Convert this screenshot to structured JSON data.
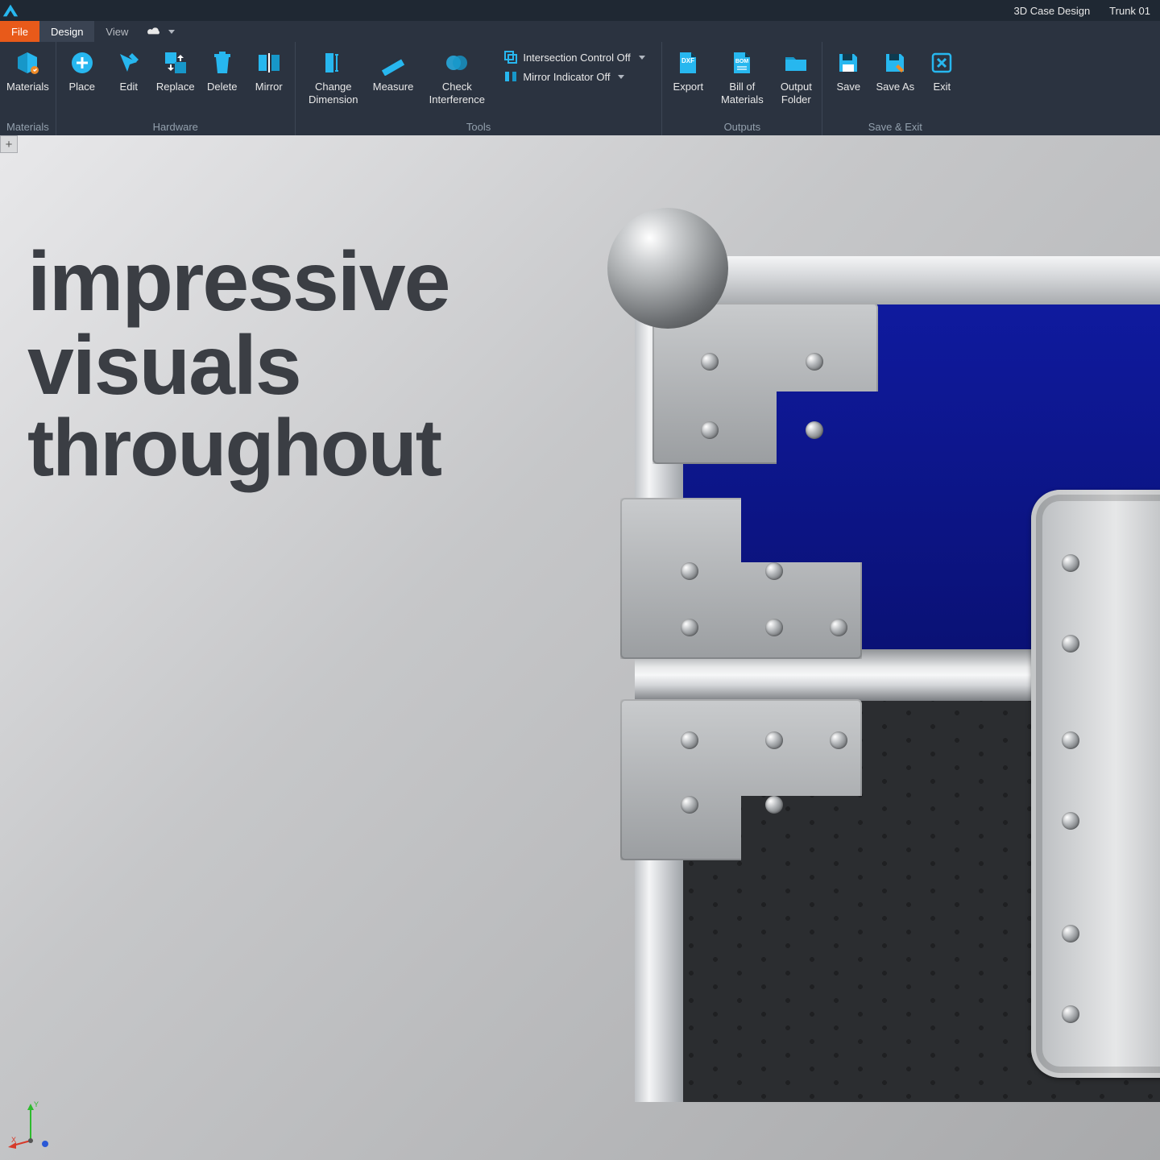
{
  "titlebar": {
    "app": "3D Case Design",
    "doc": "Trunk 01"
  },
  "menu": {
    "file": "File",
    "design": "Design",
    "view": "View"
  },
  "ribbon": {
    "materials": {
      "label": "Materials",
      "materials_btn": "Materials"
    },
    "hardware": {
      "label": "Hardware",
      "place": "Place",
      "edit": "Edit",
      "replace": "Replace",
      "delete": "Delete",
      "mirror": "Mirror"
    },
    "tools": {
      "label": "Tools",
      "change_dim": "Change\nDimension",
      "measure": "Measure",
      "check_interf": "Check\nInterference",
      "intersection": "Intersection Control Off",
      "mirror_indicator": "Mirror Indicator Off"
    },
    "outputs": {
      "label": "Outputs",
      "export": "Export",
      "bom": "Bill of\nMaterials",
      "folder": "Output\nFolder"
    },
    "save_exit": {
      "label": "Save & Exit",
      "save": "Save",
      "save_as": "Save As",
      "exit": "Exit"
    }
  },
  "overlay": {
    "line1": "impressive",
    "line2": "visuals",
    "line3": "throughout"
  },
  "axis": {
    "x": "X",
    "y": "Y",
    "z": "Z"
  }
}
